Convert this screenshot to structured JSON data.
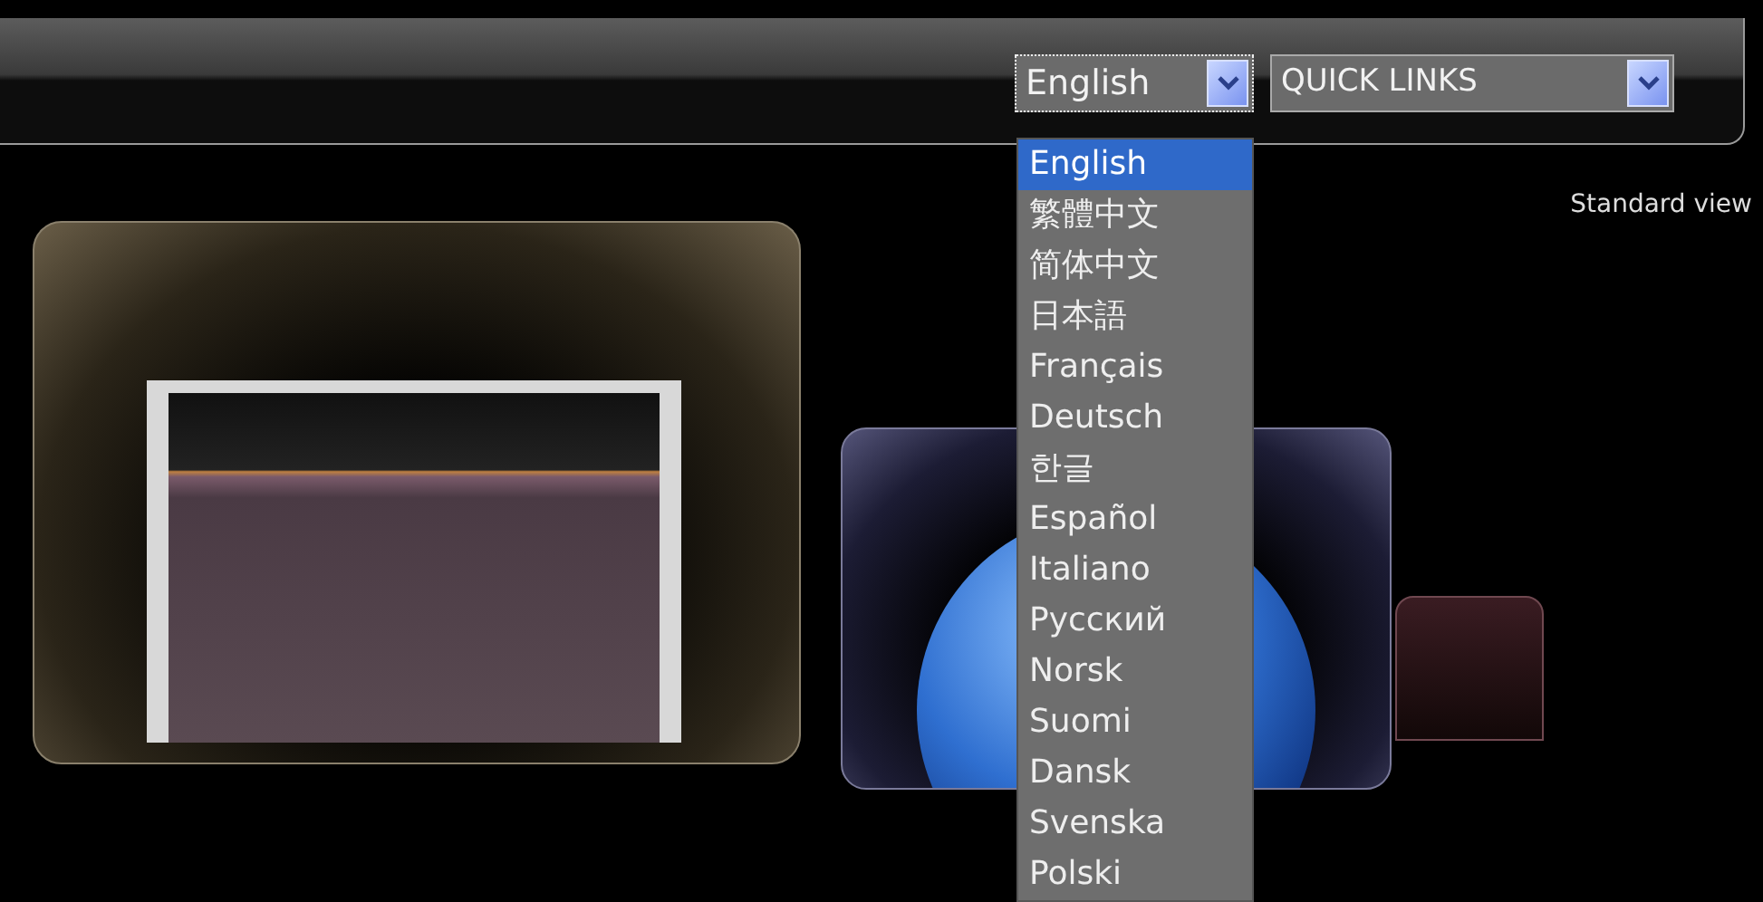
{
  "language_select": {
    "value": "English",
    "expanded": true,
    "options": [
      {
        "label": "English",
        "selected": true
      },
      {
        "label": "繁體中文",
        "selected": false
      },
      {
        "label": "简体中文",
        "selected": false
      },
      {
        "label": "日本語",
        "selected": false
      },
      {
        "label": "Français",
        "selected": false
      },
      {
        "label": "Deutsch",
        "selected": false
      },
      {
        "label": "한글",
        "selected": false
      },
      {
        "label": "Español",
        "selected": false
      },
      {
        "label": "Italiano",
        "selected": false
      },
      {
        "label": "Русский",
        "selected": false
      },
      {
        "label": "Norsk",
        "selected": false
      },
      {
        "label": "Suomi",
        "selected": false
      },
      {
        "label": "Dansk",
        "selected": false
      },
      {
        "label": "Svenska",
        "selected": false
      },
      {
        "label": "Polski",
        "selected": false
      }
    ]
  },
  "quick_links_select": {
    "value": "QUICK LINKS"
  },
  "view_link": "Standard view"
}
